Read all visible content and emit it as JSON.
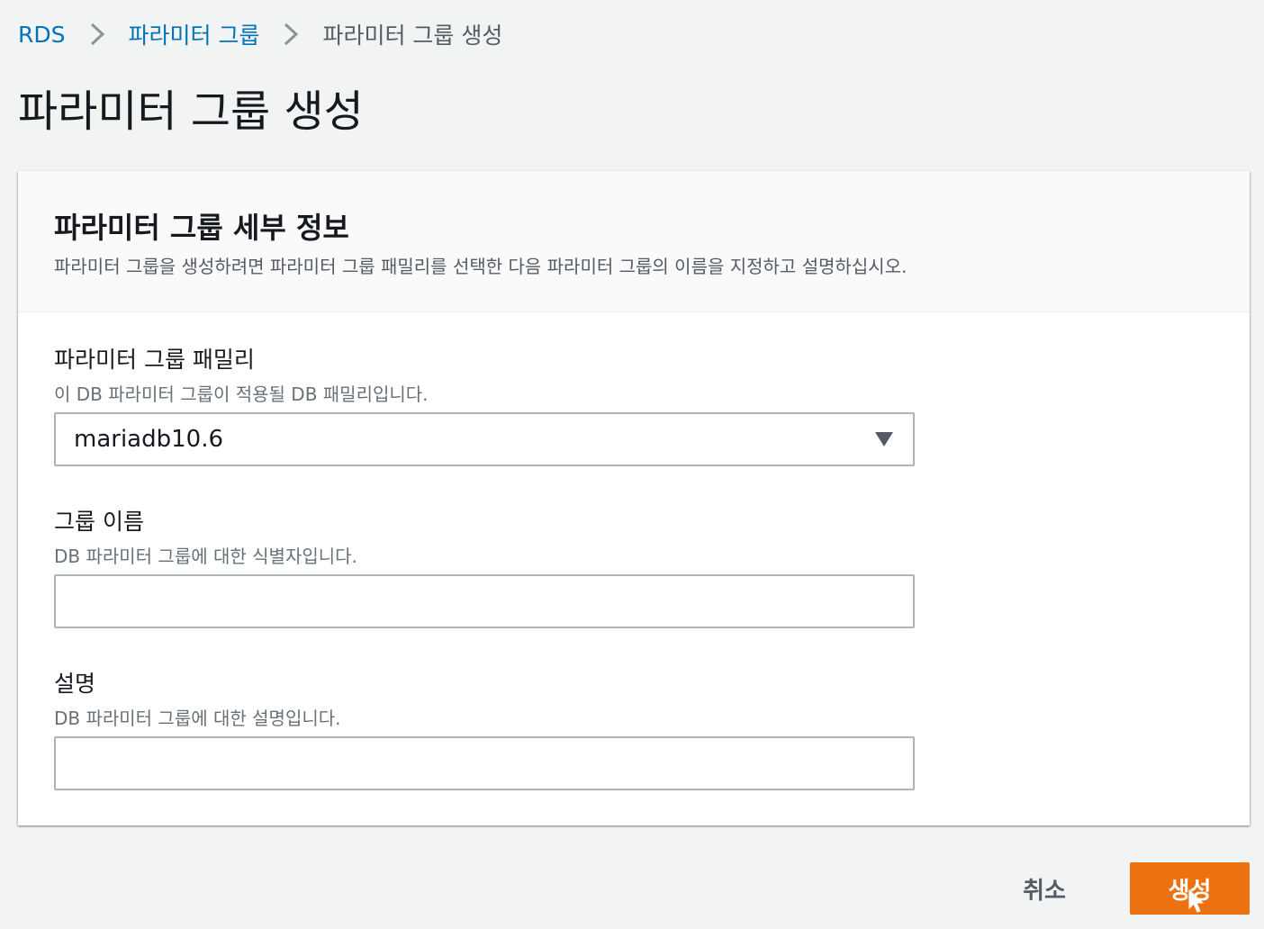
{
  "breadcrumb": {
    "items": [
      {
        "label": "RDS"
      },
      {
        "label": "파라미터 그룹"
      },
      {
        "label": "파라미터 그룹 생성"
      }
    ]
  },
  "page": {
    "title": "파라미터 그룹 생성"
  },
  "details": {
    "title": "파라미터 그룹 세부 정보",
    "description": "파라미터 그룹을 생성하려면 파라미터 그룹 패밀리를 선택한 다음 파라미터 그룹의 이름을 지정하고 설명하십시오."
  },
  "fields": {
    "family": {
      "label": "파라미터 그룹 패밀리",
      "hint": "이 DB 파라미터 그룹이 적용될 DB 패밀리입니다.",
      "value": "mariadb10.6"
    },
    "group_name": {
      "label": "그룹 이름",
      "hint": "DB 파라미터 그룹에 대한 식별자입니다.",
      "value": ""
    },
    "description": {
      "label": "설명",
      "hint": "DB 파라미터 그룹에 대한 설명입니다.",
      "value": ""
    }
  },
  "actions": {
    "cancel_label": "취소",
    "create_label": "생성"
  },
  "colors": {
    "link": "#0073bb",
    "primary_button": "#ec7211",
    "background": "#f2f3f3"
  },
  "icons": {
    "breadcrumb_separator": "chevron-right-icon",
    "select_caret": "caret-down-icon",
    "cursor": "mouse-cursor-icon"
  }
}
